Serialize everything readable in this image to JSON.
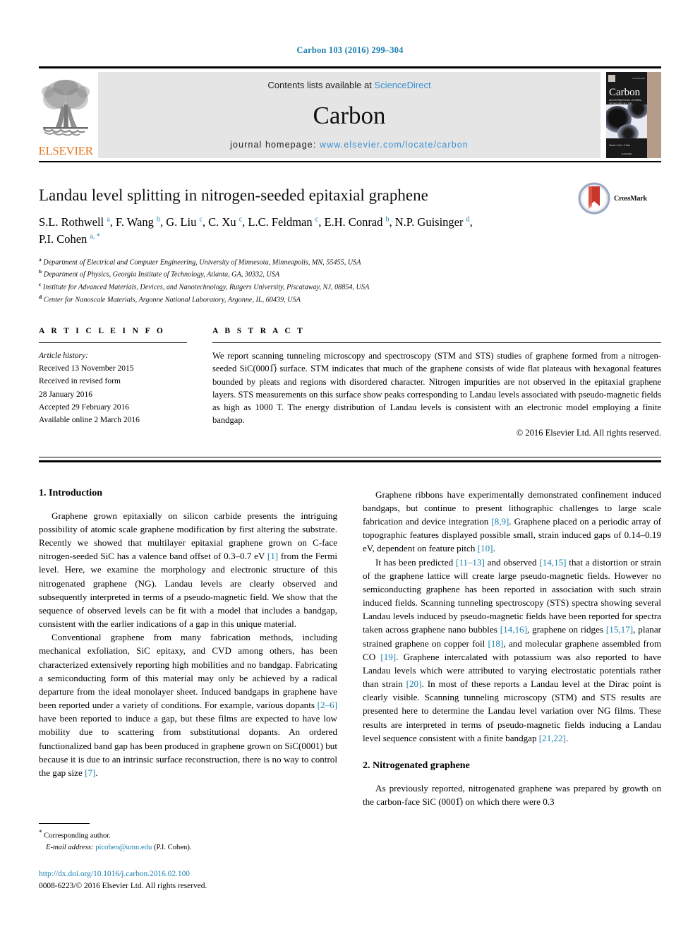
{
  "running_head": "Carbon 103 (2016) 299–304",
  "masthead": {
    "publisher_name": "ELSEVIER",
    "contents_prefix": "Contents lists available at ",
    "contents_link": "ScienceDirect",
    "journal_title": "Carbon",
    "homepage_prefix": "journal homepage: ",
    "homepage_url": "www.elsevier.com/locate/carbon",
    "cover": {
      "title": "Carbon",
      "top_left_text": "The Wind Div",
      "top_right_text": "Volume 103",
      "subtitle": "AN INTERNATIONAL JOURNAL SPONSORED BY THE AMERICAN CARBON SOCIETY",
      "footer_text": "March / Vol 1 & Mar",
      "publisher": "ELSEVIER"
    }
  },
  "article": {
    "title": "Landau level splitting in nitrogen-seeded epitaxial graphene",
    "crossmark_label": "CrossMark",
    "authors": [
      {
        "name": "S.L. Rothwell",
        "marks": "a"
      },
      {
        "name": "F. Wang",
        "marks": "b"
      },
      {
        "name": "G. Liu",
        "marks": "c"
      },
      {
        "name": "C. Xu",
        "marks": "c"
      },
      {
        "name": "L.C. Feldman",
        "marks": "c"
      },
      {
        "name": "E.H. Conrad",
        "marks": "b"
      },
      {
        "name": "N.P. Guisinger",
        "marks": "d"
      },
      {
        "name": "P.I. Cohen",
        "marks": "a, *"
      }
    ],
    "affiliations": [
      {
        "mark": "a",
        "text": "Department of Electrical and Computer Engineering, University of Minnesota, Minneapolis, MN, 55455, USA"
      },
      {
        "mark": "b",
        "text": "Department of Physics, Georgia Institute of Technology, Atlanta, GA, 30332, USA"
      },
      {
        "mark": "c",
        "text": "Institute for Advanced Materials, Devices, and Nanotechnology, Rutgers University, Piscataway, NJ, 08854, USA"
      },
      {
        "mark": "d",
        "text": "Center for Nanoscale Materials, Argonne National Laboratory, Argonne, IL, 60439, USA"
      }
    ]
  },
  "article_info": {
    "heading": "A R T I C L E   I N F O",
    "history_label": "Article history:",
    "history": [
      "Received 13 November 2015",
      "Received in revised form",
      "28 January 2016",
      "Accepted 29 February 2016",
      "Available online 2 March 2016"
    ]
  },
  "abstract": {
    "heading": "A B S T R A C T",
    "text": "We report scanning tunneling microscopy and spectroscopy (STM and STS) studies of graphene formed from a nitrogen-seeded SiC(0001̅) surface. STM indicates that much of the graphene consists of wide flat plateaus with hexagonal features bounded by pleats and regions with disordered character. Nitrogen impurities are not observed in the epitaxial graphene layers. STS measurements on this surface show peaks corresponding to Landau levels associated with pseudo-magnetic fields as high as 1000 T. The energy distribution of Landau levels is consistent with an electronic model employing a finite bandgap.",
    "copyright": "© 2016 Elsevier Ltd. All rights reserved."
  },
  "sections": {
    "introduction_heading": "1.  Introduction",
    "nitrogenated_heading": "2.  Nitrogenated graphene"
  },
  "paragraphs": {
    "intro_p1_a": "Graphene grown epitaxially on silicon carbide presents the intriguing possibility of atomic scale graphene modification by first altering the substrate. Recently we showed that multilayer epitaxial graphene grown on C-face nitrogen-seeded SiC has a valence band offset of 0.3–0.7 eV ",
    "intro_p1_ref": "[1]",
    "intro_p1_b": " from the Fermi level. Here, we examine the morphology and electronic structure of this nitrogenated graphene (NG). Landau levels are clearly observed and subsequently interpreted in terms of a pseudo-magnetic field. We show that the sequence of observed levels can be fit with a model that includes a bandgap, consistent with the earlier indications of a gap in this unique material.",
    "intro_p2_a": "Conventional graphene from many fabrication methods, including mechanical exfoliation, SiC epitaxy, and CVD among others, has been characterized extensively reporting high mobilities and no bandgap. Fabricating a semiconducting form of this material may only be achieved by a radical departure from the ideal monolayer sheet. Induced bandgaps in graphene have been reported under a variety of conditions. For example, various dopants ",
    "intro_p2_ref1": "[2–6]",
    "intro_p2_b": " have been reported to induce a gap, but these films are expected to have low mobility due to scattering from substitutional dopants. An ordered functionalized band gap has been produced in graphene grown on SiC(0001) but because it is due to an intrinsic surface reconstruction, there is no way to control the gap size ",
    "intro_p2_ref2": "[7]",
    "intro_p2_c": ".",
    "right_p1_a": "Graphene ribbons have experimentally demonstrated confinement induced bandgaps, but continue to present lithographic challenges to large scale fabrication and device integration ",
    "right_p1_ref1": "[8,9]",
    "right_p1_b": ". Graphene placed on a periodic array of topographic features displayed possible small, strain induced gaps of 0.14–0.19 eV, dependent on feature pitch ",
    "right_p1_ref2": "[10]",
    "right_p1_c": ".",
    "right_p2_a": "It has been predicted ",
    "right_p2_ref1": "[11–13]",
    "right_p2_b": " and observed ",
    "right_p2_ref2": "[14,15]",
    "right_p2_c": " that a distortion or strain of the graphene lattice will create large pseudo-magnetic fields. However no semiconducting graphene has been reported in association with such strain induced fields. Scanning tunneling spectroscopy (STS) spectra showing several Landau levels induced by pseudo-magnetic fields have been reported for spectra taken across graphene nano bubbles ",
    "right_p2_ref3": "[14,16]",
    "right_p2_d": ", graphene on ridges ",
    "right_p2_ref4": "[15,17]",
    "right_p2_e": ", planar strained graphene on copper foil ",
    "right_p2_ref5": "[18]",
    "right_p2_f": ", and molecular graphene assembled from CO ",
    "right_p2_ref6": "[19]",
    "right_p2_g": ". Graphene intercalated with potassium was also reported to have Landau levels which were attributed to varying electrostatic potentials rather than strain ",
    "right_p2_ref7": "[20]",
    "right_p2_h": ". In most of these reports a Landau level at the Dirac point is clearly visible. Scanning tunneling microscopy (STM) and STS results are presented here to determine the Landau level variation over NG films. These results are interpreted in terms of pseudo-magnetic fields inducing a Landau level sequence consistent with a finite bandgap ",
    "right_p2_ref8": "[21,22]",
    "right_p2_i": ".",
    "right_p3": "As previously reported, nitrogenated graphene was prepared by growth on the carbon-face SiC (0001̅) on which there were 0.3"
  },
  "footnote": {
    "star": "*",
    "corresponding": " Corresponding author.",
    "email_label": "E-mail address:",
    "email": "picohen@umn.edu",
    "email_suffix": " (P.I. Cohen)."
  },
  "doi": {
    "url": "http://dx.doi.org/10.1016/j.carbon.2016.02.100",
    "issn_line": "0008-6223/© 2016 Elsevier Ltd. All rights reserved."
  },
  "colors": {
    "link": "#1b7eb0",
    "sciencedirect": "#3a8fd0",
    "elsevier_orange": "#e87722",
    "masthead_bg": "#e5e5e5"
  }
}
